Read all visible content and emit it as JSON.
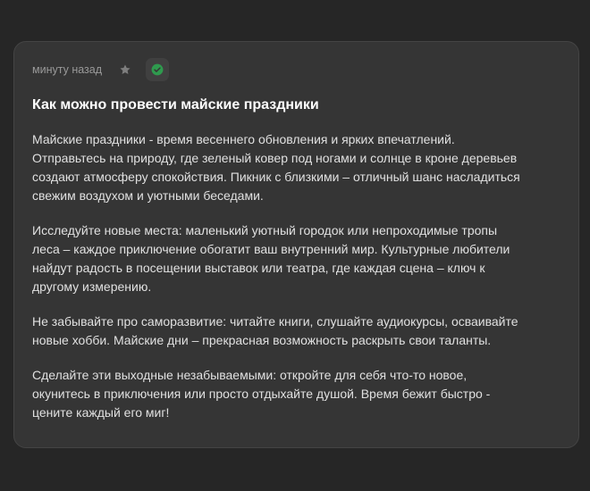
{
  "card": {
    "timestamp": "минуту назад",
    "star_icon": "star-icon",
    "check_icon": "check-circle-icon",
    "title": "Как можно провести майские праздники",
    "paragraphs": [
      "Майские праздники - время весеннего обновления и ярких впечатлений.\nОтправьтесь на природу, где зеленый ковер под ногами и солнце в кроне деревьев\nсоздают атмосферу спокойствия. Пикник с близкими – отличный шанс насладиться\nсвежим воздухом и уютными беседами.",
      "Исследуйте новые места: маленький уютный городок или непроходимые тропы\nлеса – каждое приключение обогатит ваш внутренний мир. Культурные любители\nнайдут радость в посещении выставок или театра, где каждая сцена – ключ к\nдругому измерению.",
      "Не забывайте про саморазвитие: читайте книги, слушайте аудиокурсы, осваивайте\nновые хобби. Майские дни – прекрасная возможность раскрыть свои таланты.",
      "Сделайте эти выходные незабываемыми: откройте для себя что-то новое,\nокунитесь в приключения или просто отдыхайте душой. Время бежит быстро -\nцените каждый его миг!"
    ]
  },
  "colors": {
    "background": "#262626",
    "card": "#353535",
    "accent_green": "#2f9a4e"
  }
}
